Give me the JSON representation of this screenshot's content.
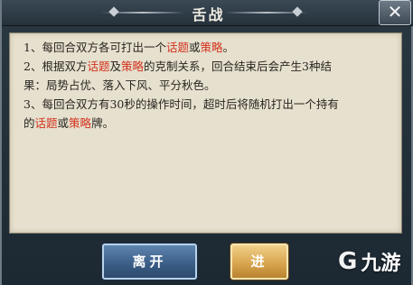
{
  "dialog": {
    "title": "舌战",
    "close_label": "✕"
  },
  "rules": {
    "line1": {
      "a": "1、每回合双方各可打出一个",
      "topic": "话题",
      "or": "或",
      "strategy": "策略",
      "end": "。"
    },
    "line2": {
      "a": "2、根据双方",
      "topic": "话题",
      "and": "及",
      "strategy": "策略",
      "rest1": "的克制关系，回合结束后会产生3种结",
      "rest2": "果：局势占优、落入下风、平分秋色。"
    },
    "line3": {
      "a": "3、每回合双方有30秒的操作时间，超时后将随机打出一个持有",
      "b": "的",
      "topic": "话题",
      "or": "或",
      "strategy": "策略",
      "end": "牌。"
    }
  },
  "buttons": {
    "leave": "离开",
    "enter": "进"
  },
  "watermark": {
    "logo": "G",
    "text": "九游"
  },
  "colors": {
    "highlight": "#d2321e",
    "leave_button": "#3b5f88",
    "enter_button": "#d9a650"
  }
}
